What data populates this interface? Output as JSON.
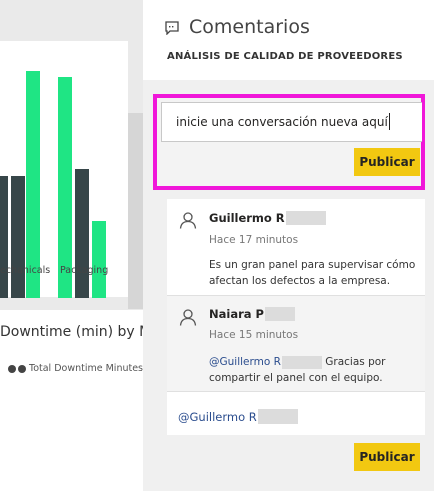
{
  "dashboard": {
    "chart_labels": [
      "echanicals",
      "Packaging"
    ],
    "downtime_title": "Downtime (min) by M",
    "legend_label": "Total Downtime Minutes",
    "colors": {
      "series_green": "#1fe584",
      "series_dark": "#374649",
      "background": "#eaeaea"
    }
  },
  "comments_pane": {
    "title": "Comentarios",
    "subtitle": "ANÁLISIS DE CALIDAD DE PROVEEDORES",
    "icon": "comment-icon",
    "new_comment": {
      "placeholder": "inicie una conversación nueva aquí",
      "publish_label": "Publicar",
      "highlight_color": "#f017d9"
    },
    "comments": [
      {
        "author": "Guillermo R",
        "time": "Hace 17 minutos",
        "text": "Es un gran panel para supervisar cómo afectan los defectos a la empresa."
      },
      {
        "author": "Naiara P",
        "time": "Hace 15 minutos",
        "mention": "@Guillermo R",
        "text": "Gracias por compartir el panel con el equipo."
      }
    ],
    "reply": {
      "mention": "@Guillermo R",
      "publish_label": "Publicar"
    },
    "accent_color": "#f2c811"
  }
}
